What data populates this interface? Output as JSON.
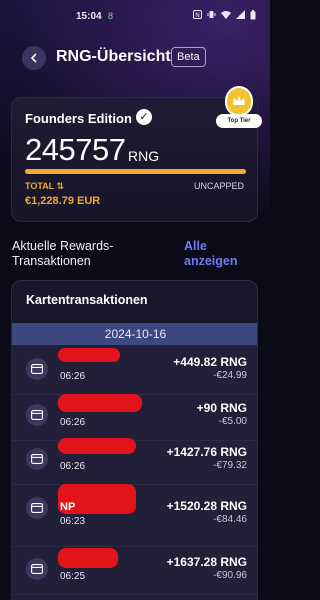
{
  "status_bar": {
    "time": "15:04",
    "indicator": "8",
    "icons": [
      "nfc-icon",
      "vibrate-icon",
      "wifi-icon",
      "signal-icon",
      "battery-icon"
    ]
  },
  "header": {
    "title": "RNG-Übersicht",
    "badge": "Beta"
  },
  "founders": {
    "title": "Founders Edition",
    "amount": "245757",
    "unit": "RNG",
    "total_label": "TOTAL ⇅",
    "uncapped_label": "UNCAPPED",
    "eur_value": "€1,228.79 EUR",
    "progress": 1.0,
    "tier_label": "Top Tier"
  },
  "rewards": {
    "title": "Aktuelle Rewards-Transaktionen",
    "link": "Alle anzeigen"
  },
  "card_transactions": {
    "title": "Kartentransaktionen",
    "date": "2024-10-16",
    "items": [
      {
        "name": "",
        "time": "06:26",
        "rng": "+449.82 RNG",
        "eur": "-€24.99"
      },
      {
        "name": "",
        "time": "06:26",
        "rng": "+90 RNG",
        "eur": "-€5.00"
      },
      {
        "name": "",
        "time": "06:26",
        "rng": "+1427.76 RNG",
        "eur": "-€79.32"
      },
      {
        "name": "NP",
        "time": "06:23",
        "rng": "+1520.28 RNG",
        "eur": "-€84.46"
      },
      {
        "name": "",
        "time": "06:25",
        "rng": "+1637.28 RNG",
        "eur": "-€90.96"
      }
    ]
  },
  "colors": {
    "accent": "#f0a935",
    "link": "#6f7cf0",
    "date_header": "#3d4780",
    "redaction": "#e8141a"
  }
}
